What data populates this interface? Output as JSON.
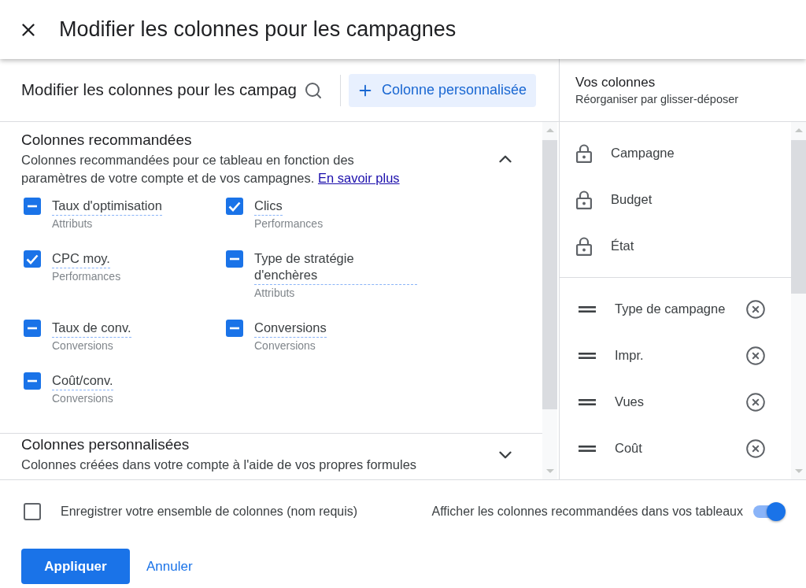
{
  "dialog": {
    "title": "Modifier les colonnes pour les campagnes"
  },
  "toolbar": {
    "search": {
      "value": "Modifier les colonnes pour les campag"
    },
    "add_button": "Colonne personnalisée"
  },
  "sections": [
    {
      "title": "Colonnes recommandées",
      "description": "Colonnes recommandées pour ce tableau en fonction des paramètres de votre compte et de vos campagnes.",
      "link": "En savoir plus",
      "expanded": true,
      "items": [
        {
          "label": "Taux d'optimisation",
          "category": "Attributs",
          "checked": false,
          "indeterminate": true
        },
        {
          "label": "Clics",
          "category": "Performances",
          "checked": true,
          "indeterminate": false
        },
        {
          "label": "CPC moy.",
          "category": "Performances",
          "checked": true,
          "indeterminate": false
        },
        {
          "label": "Type de stratégie d'enchères",
          "category": "Attributs",
          "checked": false,
          "indeterminate": true
        },
        {
          "label": "Taux de conv.",
          "category": "Conversions",
          "checked": false,
          "indeterminate": true
        },
        {
          "label": "Conversions",
          "category": "Conversions",
          "checked": false,
          "indeterminate": true
        },
        {
          "label": "Coût/conv.",
          "category": "Conversions",
          "checked": false,
          "indeterminate": true
        }
      ]
    },
    {
      "title": "Colonnes personnalisées",
      "description": "Colonnes créées dans votre compte à l'aide de vos propres formules",
      "expanded": false
    }
  ],
  "your_columns": {
    "title": "Vos colonnes",
    "subtitle": "Réorganiser par glisser-déposer",
    "locked": [
      "Campagne",
      "Budget",
      "État"
    ],
    "movable": [
      "Type de campagne",
      "Impr.",
      "Vues",
      "Coût"
    ]
  },
  "footer": {
    "save_set": {
      "label": "Enregistrer votre ensemble de colonnes (nom requis)",
      "checked": false
    },
    "show_recommended": {
      "label": "Afficher les colonnes recommandées dans vos tableaux",
      "on": true
    },
    "buttons": [
      {
        "label": "Appliquer",
        "kind": "primary"
      },
      {
        "label": "Annuler",
        "kind": "text"
      }
    ]
  }
}
